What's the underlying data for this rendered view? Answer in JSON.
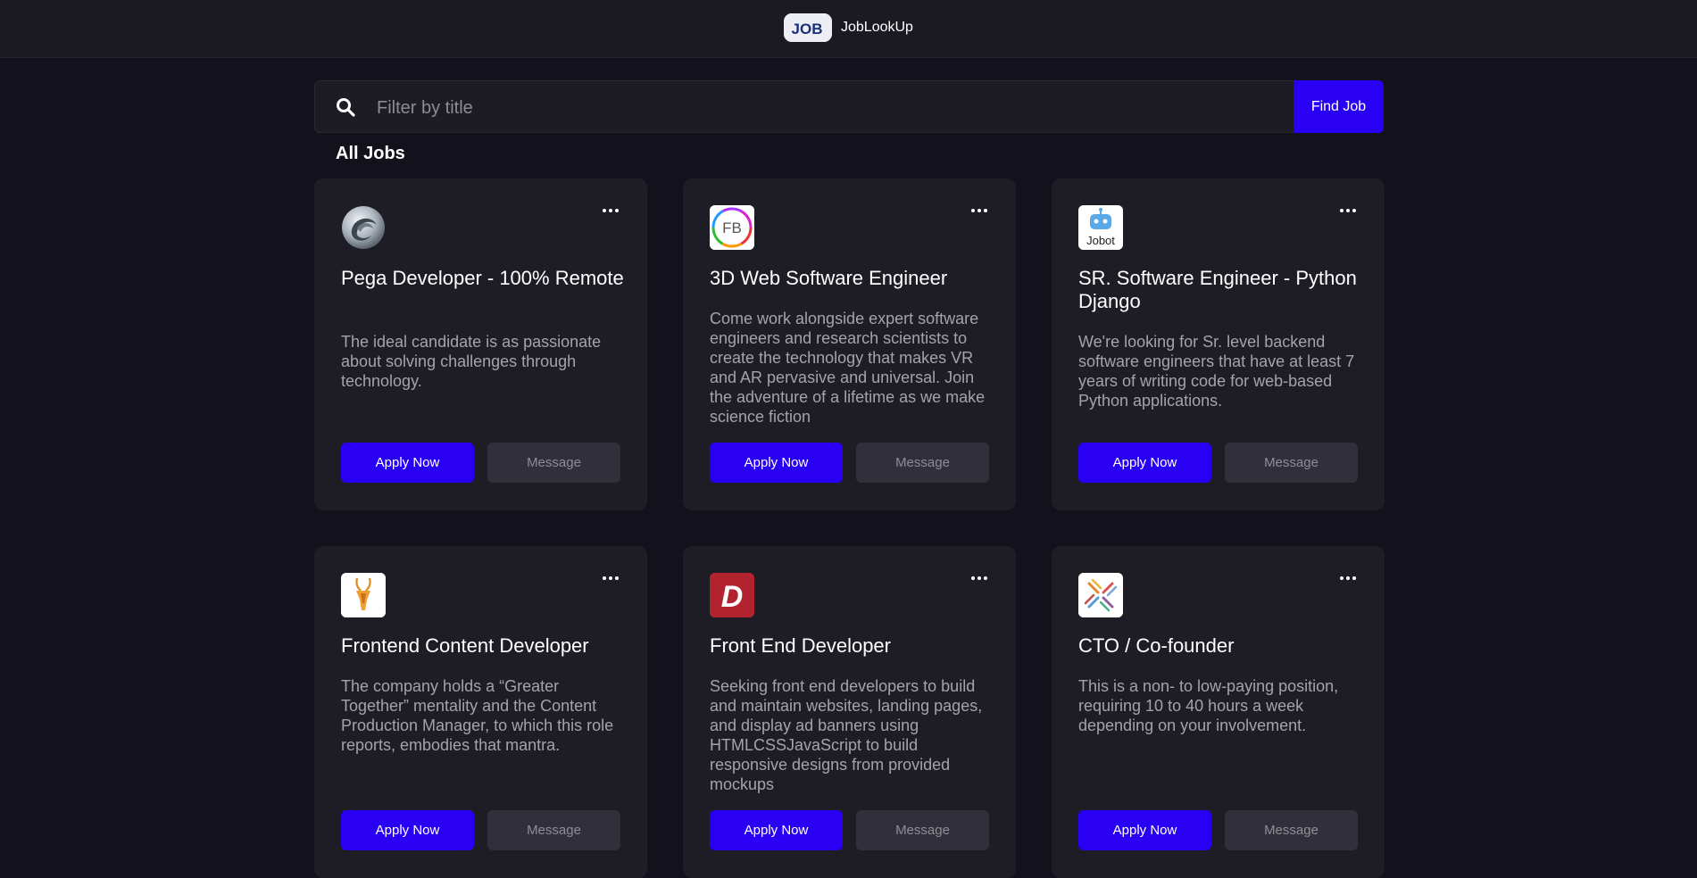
{
  "header": {
    "logo_text": "JOB",
    "app_name": "JobLookUp"
  },
  "search": {
    "placeholder": "Filter by title",
    "value": "",
    "button_label": "Find Job"
  },
  "section": {
    "title": "All Jobs"
  },
  "buttons": {
    "apply": "Apply Now",
    "message": "Message"
  },
  "jobs": [
    {
      "logo": "pega-swirl-logo",
      "title": "Pega Developer - 100% Remote",
      "description": "The ideal candidate is as passionate about solving challenges through technology."
    },
    {
      "logo": "fb-ring-logo",
      "logo_text": "FB",
      "title": "3D Web Software Engineer",
      "description": "Come work alongside expert software engineers and research scientists to create the technology that makes VR and AR pervasive and universal. Join the adventure of a lifetime as we make science fiction"
    },
    {
      "logo": "jobot-robot-logo",
      "logo_text": "Jobot",
      "title": "SR. Software Engineer - Python Django",
      "description": "We're looking for Sr. level backend software engineers that have at least 7 years of writing code for web-based Python applications."
    },
    {
      "logo": "antelope-logo",
      "title": "Frontend Content Developer",
      "description": "The company holds a “Greater Together” mentality and the Content Production Manager, to which this role reports, embodies that mantra."
    },
    {
      "logo": "d-letter-logo",
      "logo_text": "D",
      "title": "Front End Developer",
      "description": "Seeking front end developers to build and maintain websites, landing pages, and display ad banners using HTMLCSSJavaScript to build responsive designs from provided mockups"
    },
    {
      "logo": "x-pattern-logo",
      "title": "CTO / Co-founder",
      "description": "This is a non- to low-paying position, requiring 10 to 40 hours a week depending on your involvement."
    }
  ],
  "colors": {
    "background": "#13121c",
    "card": "#1e1d26",
    "accent": "#2a00f5",
    "secondary_button": "#31303a"
  }
}
